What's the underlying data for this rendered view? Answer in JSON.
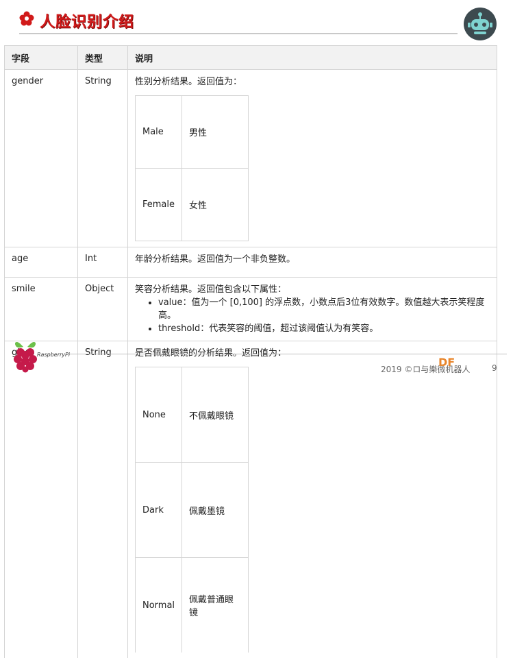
{
  "title": "人脸识别介绍",
  "table": {
    "headers": [
      "字段",
      "类型",
      "说明"
    ],
    "rows": {
      "gender": {
        "field": "gender",
        "type": "String",
        "desc": "性别分析结果。返回值为：",
        "values": [
          [
            "Male",
            "男性"
          ],
          [
            "Female",
            "女性"
          ]
        ]
      },
      "age": {
        "field": "age",
        "type": "Int",
        "desc": "年龄分析结果。返回值为一个非负整数。"
      },
      "smile": {
        "field": "smile",
        "type": "Object",
        "desc": "笑容分析结果。返回值包含以下属性：",
        "bullets": [
          "value：值为一个 [0,100] 的浮点数，小数点后3位有效数字。数值越大表示笑程度高。",
          "threshold：代表笑容的阈值，超过该阈值认为有笑容。"
        ]
      },
      "glass": {
        "field": "glass",
        "type": "String",
        "desc": "是否佩戴眼镜的分析结果。返回值为：",
        "values": [
          [
            "None",
            "不佩戴眼镜"
          ],
          [
            "Dark",
            "佩戴墨镜"
          ],
          [
            "Normal",
            "佩戴普通眼镜"
          ]
        ]
      }
    }
  },
  "footer": {
    "logo_text": "RaspberryPi",
    "year_text": "2019 ©ロ与樂微机器人",
    "brand": "DF",
    "page": "9"
  },
  "colors": {
    "title_red": "#d11a1a",
    "robot_bg": "#3d4a4f",
    "robot_face": "#7fd3d0",
    "brand_orange": "#e8862c"
  },
  "icons": {
    "title": "flower-icon",
    "corner": "robot-logo-icon",
    "footer": "raspberry-pi-logo-icon"
  }
}
